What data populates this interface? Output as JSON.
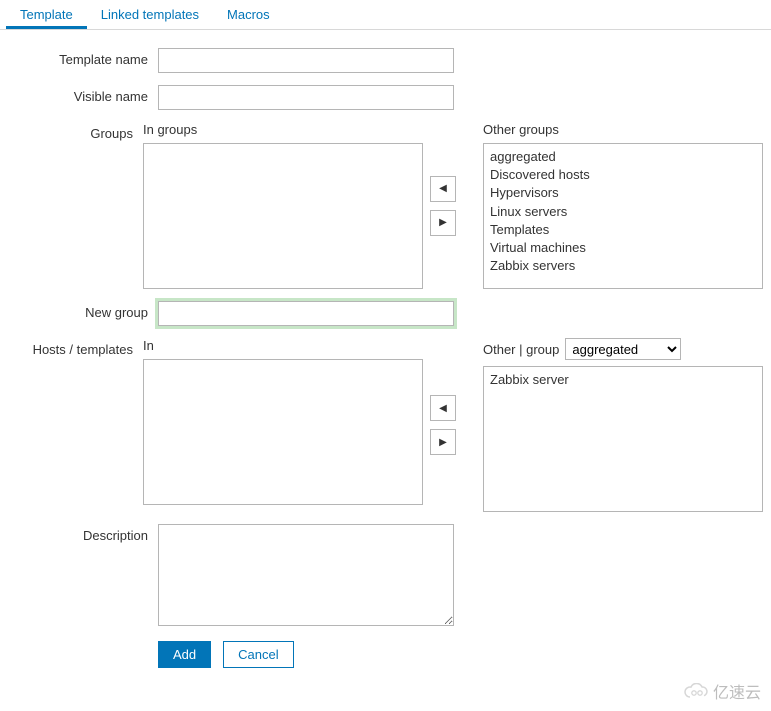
{
  "tabs": {
    "template": "Template",
    "linked": "Linked templates",
    "macros": "Macros"
  },
  "labels": {
    "template_name": "Template name",
    "visible_name": "Visible name",
    "groups": "Groups",
    "in_groups": "In groups",
    "other_groups": "Other groups",
    "new_group": "New group",
    "hosts_templates": "Hosts / templates",
    "in": "In",
    "other_group_pipe": "Other | group",
    "description": "Description"
  },
  "values": {
    "template_name": "",
    "visible_name": "",
    "new_group": "",
    "description": "",
    "group_select": "aggregated"
  },
  "other_groups_list": [
    "aggregated",
    "Discovered hosts",
    "Hypervisors",
    "Linux servers",
    "Templates",
    "Virtual machines",
    "Zabbix servers"
  ],
  "in_groups_list": [],
  "in_hosts_list": [],
  "other_hosts_list": [
    "Zabbix server"
  ],
  "group_select_options": [
    "aggregated"
  ],
  "buttons": {
    "add": "Add",
    "cancel": "Cancel"
  },
  "watermark": "亿速云"
}
